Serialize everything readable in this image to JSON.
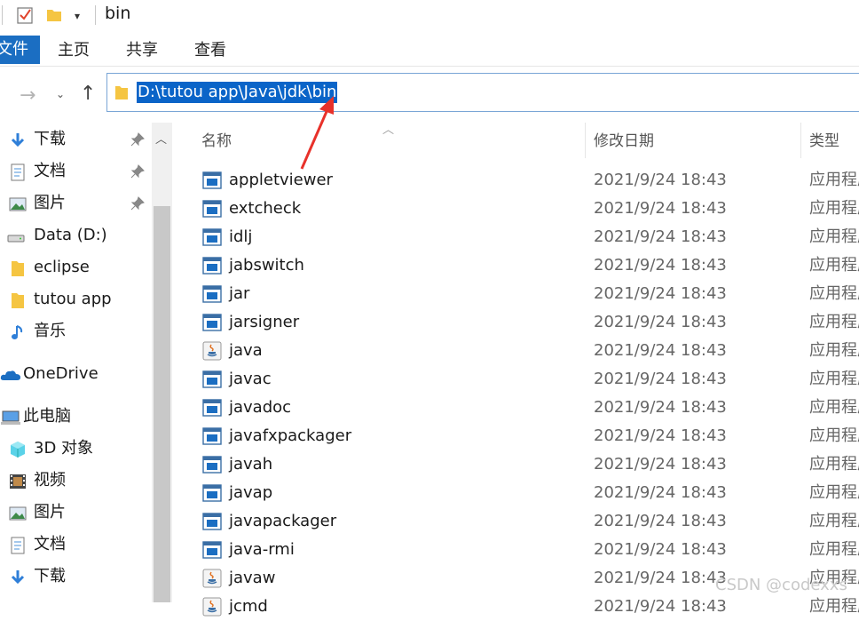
{
  "title": "bin",
  "ribbon": {
    "file_tab": "文件",
    "tabs": [
      "主页",
      "共享",
      "查看"
    ]
  },
  "address": {
    "path": "D:\\tutou app\\Java\\jdk\\bin"
  },
  "sidebar": {
    "items": [
      {
        "label": "下载",
        "icon": "download-icon",
        "pinned": true
      },
      {
        "label": "文档",
        "icon": "document-icon",
        "pinned": true
      },
      {
        "label": "图片",
        "icon": "pictures-icon",
        "pinned": true
      },
      {
        "label": "Data (D:)",
        "icon": "drive-icon",
        "pinned": false
      },
      {
        "label": "eclipse",
        "icon": "folder-icon",
        "pinned": false
      },
      {
        "label": "tutou app",
        "icon": "folder-icon",
        "pinned": false
      },
      {
        "label": "音乐",
        "icon": "music-icon",
        "pinned": false
      },
      {
        "label": "OneDrive",
        "icon": "cloud-icon",
        "pinned": false
      },
      {
        "label": "此电脑",
        "icon": "computer-icon",
        "pinned": false
      },
      {
        "label": "3D 对象",
        "icon": "3d-objects-icon",
        "pinned": false
      },
      {
        "label": "视频",
        "icon": "video-icon",
        "pinned": false
      },
      {
        "label": "图片",
        "icon": "pictures-icon",
        "pinned": false
      },
      {
        "label": "文档",
        "icon": "document-icon",
        "pinned": false
      },
      {
        "label": "下载",
        "icon": "download-icon",
        "pinned": false
      }
    ]
  },
  "columns": {
    "name": "名称",
    "modified": "修改日期",
    "type": "类型"
  },
  "files": [
    {
      "name": "appletviewer",
      "date": "2021/9/24 18:43",
      "type": "应用程序",
      "icon": "exe-icon"
    },
    {
      "name": "extcheck",
      "date": "2021/9/24 18:43",
      "type": "应用程序",
      "icon": "exe-icon"
    },
    {
      "name": "idlj",
      "date": "2021/9/24 18:43",
      "type": "应用程序",
      "icon": "exe-icon"
    },
    {
      "name": "jabswitch",
      "date": "2021/9/24 18:43",
      "type": "应用程序",
      "icon": "exe-icon"
    },
    {
      "name": "jar",
      "date": "2021/9/24 18:43",
      "type": "应用程序",
      "icon": "exe-icon"
    },
    {
      "name": "jarsigner",
      "date": "2021/9/24 18:43",
      "type": "应用程序",
      "icon": "exe-icon"
    },
    {
      "name": "java",
      "date": "2021/9/24 18:43",
      "type": "应用程序",
      "icon": "java-icon"
    },
    {
      "name": "javac",
      "date": "2021/9/24 18:43",
      "type": "应用程序",
      "icon": "exe-icon"
    },
    {
      "name": "javadoc",
      "date": "2021/9/24 18:43",
      "type": "应用程序",
      "icon": "exe-icon"
    },
    {
      "name": "javafxpackager",
      "date": "2021/9/24 18:43",
      "type": "应用程序",
      "icon": "exe-icon"
    },
    {
      "name": "javah",
      "date": "2021/9/24 18:43",
      "type": "应用程序",
      "icon": "exe-icon"
    },
    {
      "name": "javap",
      "date": "2021/9/24 18:43",
      "type": "应用程序",
      "icon": "exe-icon"
    },
    {
      "name": "javapackager",
      "date": "2021/9/24 18:43",
      "type": "应用程序",
      "icon": "exe-icon"
    },
    {
      "name": "java-rmi",
      "date": "2021/9/24 18:43",
      "type": "应用程序",
      "icon": "exe-icon"
    },
    {
      "name": "javaw",
      "date": "2021/9/24 18:43",
      "type": "应用程序",
      "icon": "java-icon"
    },
    {
      "name": "jcmd",
      "date": "2021/9/24 18:43",
      "type": "应用程序",
      "icon": "java-icon"
    }
  ],
  "watermark": "CSDN @codexxs",
  "colors": {
    "accent": "#1b6ec2",
    "selection": "#0a64c8",
    "annotation_arrow": "#e8312a"
  }
}
